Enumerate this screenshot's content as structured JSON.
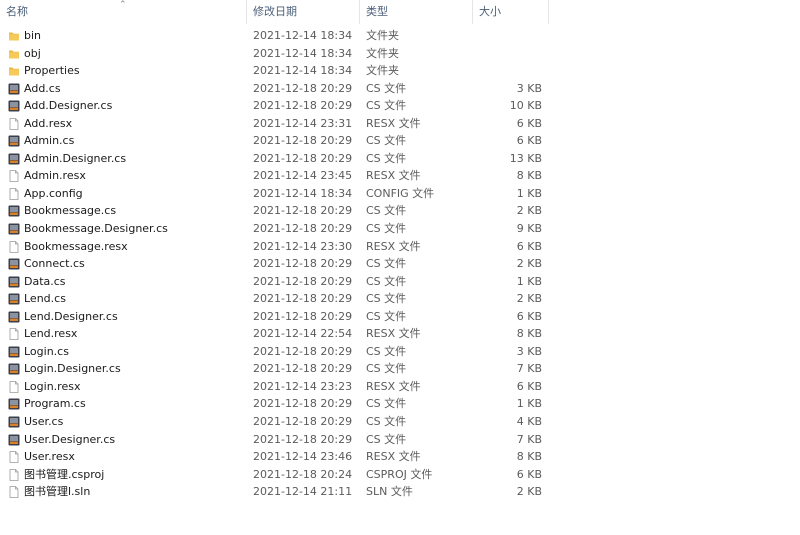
{
  "columns": {
    "name": "名称",
    "date": "修改日期",
    "type": "类型",
    "size": "大小"
  },
  "files": [
    {
      "name": "bin",
      "date": "2021-12-14 18:34",
      "type": "文件夹",
      "size": "",
      "icon": "folder-icon"
    },
    {
      "name": "obj",
      "date": "2021-12-14 18:34",
      "type": "文件夹",
      "size": "",
      "icon": "folder-icon"
    },
    {
      "name": "Properties",
      "date": "2021-12-14 18:34",
      "type": "文件夹",
      "size": "",
      "icon": "folder-icon"
    },
    {
      "name": "Add.cs",
      "date": "2021-12-18 20:29",
      "type": "CS 文件",
      "size": "3 KB",
      "icon": "cs-file-icon"
    },
    {
      "name": "Add.Designer.cs",
      "date": "2021-12-18 20:29",
      "type": "CS 文件",
      "size": "10 KB",
      "icon": "cs-file-icon"
    },
    {
      "name": "Add.resx",
      "date": "2021-12-14 23:31",
      "type": "RESX 文件",
      "size": "6 KB",
      "icon": "blank-file-icon"
    },
    {
      "name": "Admin.cs",
      "date": "2021-12-18 20:29",
      "type": "CS 文件",
      "size": "6 KB",
      "icon": "cs-file-icon"
    },
    {
      "name": "Admin.Designer.cs",
      "date": "2021-12-18 20:29",
      "type": "CS 文件",
      "size": "13 KB",
      "icon": "cs-file-icon"
    },
    {
      "name": "Admin.resx",
      "date": "2021-12-14 23:45",
      "type": "RESX 文件",
      "size": "8 KB",
      "icon": "blank-file-icon"
    },
    {
      "name": "App.config",
      "date": "2021-12-14 18:34",
      "type": "CONFIG 文件",
      "size": "1 KB",
      "icon": "blank-file-icon"
    },
    {
      "name": "Bookmessage.cs",
      "date": "2021-12-18 20:29",
      "type": "CS 文件",
      "size": "2 KB",
      "icon": "cs-file-icon"
    },
    {
      "name": "Bookmessage.Designer.cs",
      "date": "2021-12-18 20:29",
      "type": "CS 文件",
      "size": "9 KB",
      "icon": "cs-file-icon"
    },
    {
      "name": "Bookmessage.resx",
      "date": "2021-12-14 23:30",
      "type": "RESX 文件",
      "size": "6 KB",
      "icon": "blank-file-icon"
    },
    {
      "name": "Connect.cs",
      "date": "2021-12-18 20:29",
      "type": "CS 文件",
      "size": "2 KB",
      "icon": "cs-file-icon"
    },
    {
      "name": "Data.cs",
      "date": "2021-12-18 20:29",
      "type": "CS 文件",
      "size": "1 KB",
      "icon": "cs-file-icon"
    },
    {
      "name": "Lend.cs",
      "date": "2021-12-18 20:29",
      "type": "CS 文件",
      "size": "2 KB",
      "icon": "cs-file-icon"
    },
    {
      "name": "Lend.Designer.cs",
      "date": "2021-12-18 20:29",
      "type": "CS 文件",
      "size": "6 KB",
      "icon": "cs-file-icon"
    },
    {
      "name": "Lend.resx",
      "date": "2021-12-14 22:54",
      "type": "RESX 文件",
      "size": "8 KB",
      "icon": "blank-file-icon"
    },
    {
      "name": "Login.cs",
      "date": "2021-12-18 20:29",
      "type": "CS 文件",
      "size": "3 KB",
      "icon": "cs-file-icon"
    },
    {
      "name": "Login.Designer.cs",
      "date": "2021-12-18 20:29",
      "type": "CS 文件",
      "size": "7 KB",
      "icon": "cs-file-icon"
    },
    {
      "name": "Login.resx",
      "date": "2021-12-14 23:23",
      "type": "RESX 文件",
      "size": "6 KB",
      "icon": "blank-file-icon"
    },
    {
      "name": "Program.cs",
      "date": "2021-12-18 20:29",
      "type": "CS 文件",
      "size": "1 KB",
      "icon": "cs-file-icon"
    },
    {
      "name": "User.cs",
      "date": "2021-12-18 20:29",
      "type": "CS 文件",
      "size": "4 KB",
      "icon": "cs-file-icon"
    },
    {
      "name": "User.Designer.cs",
      "date": "2021-12-18 20:29",
      "type": "CS 文件",
      "size": "7 KB",
      "icon": "cs-file-icon"
    },
    {
      "name": "User.resx",
      "date": "2021-12-14 23:46",
      "type": "RESX 文件",
      "size": "8 KB",
      "icon": "blank-file-icon"
    },
    {
      "name": "图书管理.csproj",
      "date": "2021-12-18 20:24",
      "type": "CSPROJ 文件",
      "size": "6 KB",
      "icon": "blank-file-icon"
    },
    {
      "name": "图书管理l.sln",
      "date": "2021-12-14 21:11",
      "type": "SLN 文件",
      "size": "2 KB",
      "icon": "blank-file-icon"
    }
  ],
  "colors": {
    "header_text": "#4c607a",
    "folder": "#e8b744",
    "cs_icon_dark": "#3a3f4a",
    "cs_icon_accent": "#d9822b"
  }
}
